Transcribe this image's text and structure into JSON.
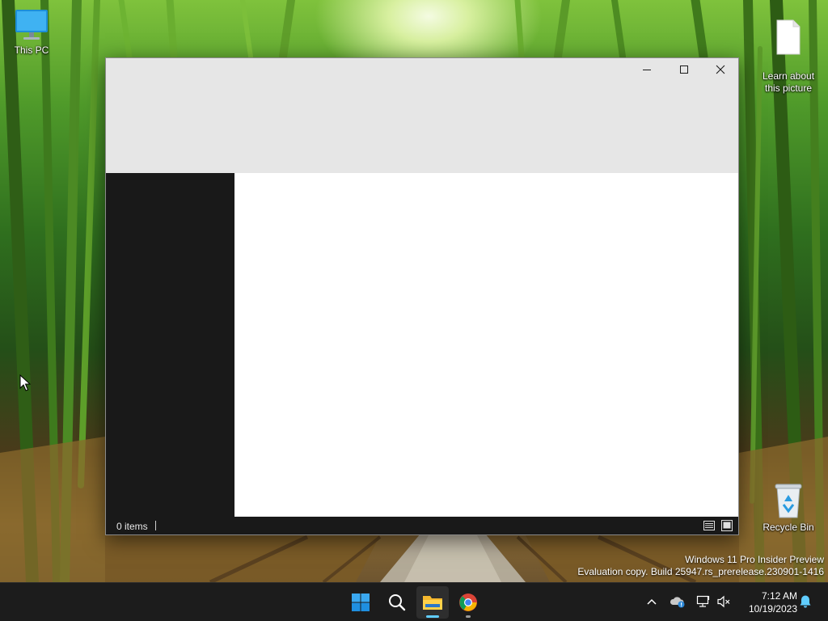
{
  "desktop": {
    "icons": [
      {
        "label": "This PC",
        "icon": "monitor-icon"
      },
      {
        "label": "Learn about\nthis picture",
        "icon": "document-icon"
      },
      {
        "label": "Recycle Bin",
        "icon": "recycle-bin-icon"
      }
    ],
    "watermark": {
      "line1": "Windows 11 Pro Insider Preview",
      "line2": "Evaluation copy. Build 25947.rs_prerelease.230901-1416"
    }
  },
  "window": {
    "caption_buttons": [
      "minimize-icon",
      "maximize-icon",
      "close-icon"
    ],
    "status": {
      "item_count": "0 items",
      "view_buttons": [
        "details-view-icon",
        "tiles-view-icon"
      ]
    }
  },
  "taskbar": {
    "apps": [
      {
        "name": "Start",
        "icon": "windows-logo-icon",
        "state": "idle"
      },
      {
        "name": "Search",
        "icon": "search-icon",
        "state": "idle"
      },
      {
        "name": "File Explorer",
        "icon": "folder-icon",
        "state": "active"
      },
      {
        "name": "Google Chrome",
        "icon": "chrome-icon",
        "state": "running"
      }
    ],
    "tray": {
      "icons": [
        "chevron-up-icon",
        "onedrive-icon",
        "network-icon",
        "volume-muted-icon",
        "notification-bell-icon"
      ],
      "time": "7:12 AM",
      "date": "10/19/2023"
    }
  },
  "colors": {
    "accent": "#60cdff",
    "window_chrome": "#e6e6e6",
    "nav_pane": "#191919",
    "content": "#ffffff",
    "taskbar": "#1c1c1c"
  }
}
